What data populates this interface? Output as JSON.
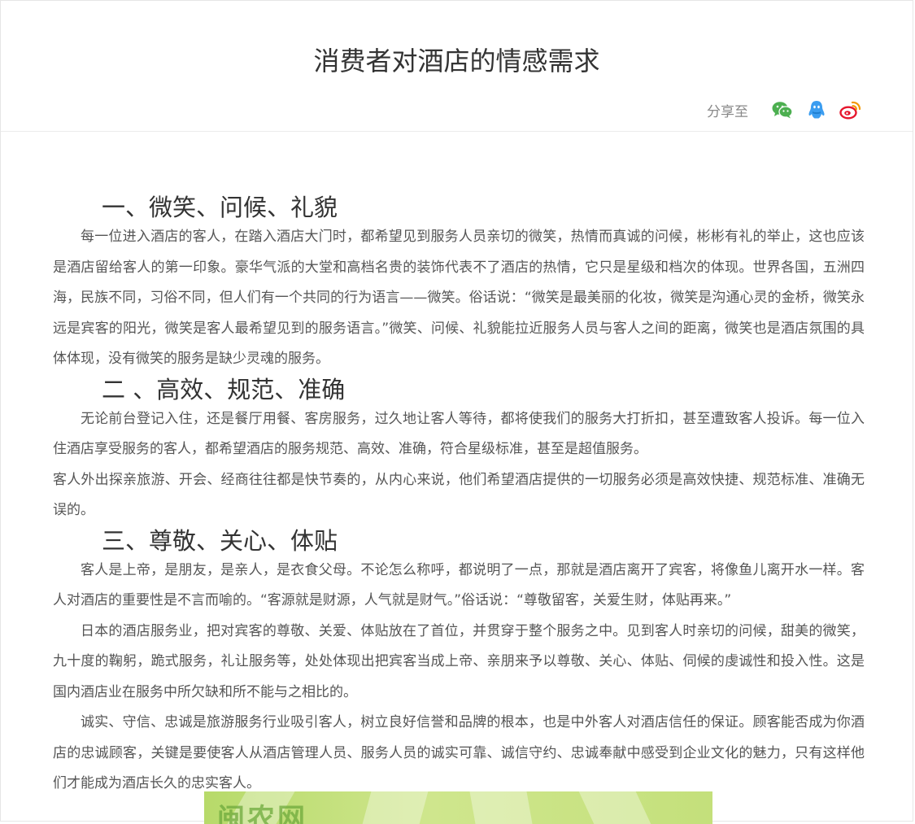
{
  "title": "消费者对酒店的情感需求",
  "share": {
    "label": "分享至",
    "icons": [
      "wechat-icon",
      "qq-icon",
      "weibo-icon"
    ],
    "colors": {
      "wechat": "#4caf50",
      "qq": "#3b9df0",
      "weibo": "#e6162d"
    }
  },
  "sections": [
    {
      "heading": "一、微笑、问候、礼貌",
      "paragraphs": [
        "每一位进入酒店的客人，在踏入酒店大门时，都希望见到服务人员亲切的微笑，热情而真诚的问候，彬彬有礼的举止，这也应该是酒店留给客人的第一印象。豪华气派的大堂和高档名贵的装饰代表不了酒店的热情，它只是星级和档次的体现。世界各国，五洲四海，民族不同，习俗不同，但人们有一个共同的行为语言——微笑。俗话说：“微笑是最美丽的化妆，微笑是沟通心灵的金桥，微笑永远是宾客的阳光，微笑是客人最希望见到的服务语言。”微笑、问候、礼貌能拉近服务人员与客人之间的距离，微笑也是酒店氛围的具体体现，没有微笑的服务是缺少灵魂的服务。"
      ]
    },
    {
      "heading": "二 、高效、规范、准确",
      "paragraphs": [
        "无论前台登记入住，还是餐厅用餐、客房服务，过久地让客人等待，都将使我们的服务大打折扣，甚至遭致客人投诉。每一位入住酒店享受服务的客人，都希望酒店的服务规范、高效、准确，符合星级标准，甚至是超值服务。",
        "客人外出探亲旅游、开会、经商往往都是快节奏的，从内心来说，他们希望酒店提供的一切服务必须是高效快捷、规范标准、准确无误的。"
      ]
    },
    {
      "heading": "三、尊敬、关心、体贴",
      "paragraphs": [
        "客人是上帝，是朋友，是亲人，是衣食父母。不论怎么称呼，都说明了一点，那就是酒店离开了宾客，将像鱼儿离开水一样。客人对酒店的重要性是不言而喻的。“客源就是财源，人气就是财气。”俗话说：“尊敬留客，关爱生财，体贴再来。”",
        "日本的酒店服务业，把对宾客的尊敬、关爱、体贴放在了首位，并贯穿于整个服务之中。见到客人时亲切的问候，甜美的微笑，九十度的鞠躬，跪式服务，礼让服务等，处处体现出把宾客当成上帝、亲朋来予以尊敬、关心、体贴、伺候的虔诚性和投入性。这是国内酒店业在服务中所欠缺和所不能与之相比的。",
        "诚实、守信、忠诚是旅游服务行业吸引客人，树立良好信誉和品牌的根本，也是中外客人对酒店信任的保证。顾客能否成为你酒店的忠诚顾客，关键是要使客人从酒店管理人员、服务人员的诚实可靠、诚信守约、忠诚奉献中感受到企业文化的魅力，只有这样他们才能成为酒店长久的忠实客人。"
      ]
    }
  ],
  "banner": {
    "text": "闽农网"
  }
}
